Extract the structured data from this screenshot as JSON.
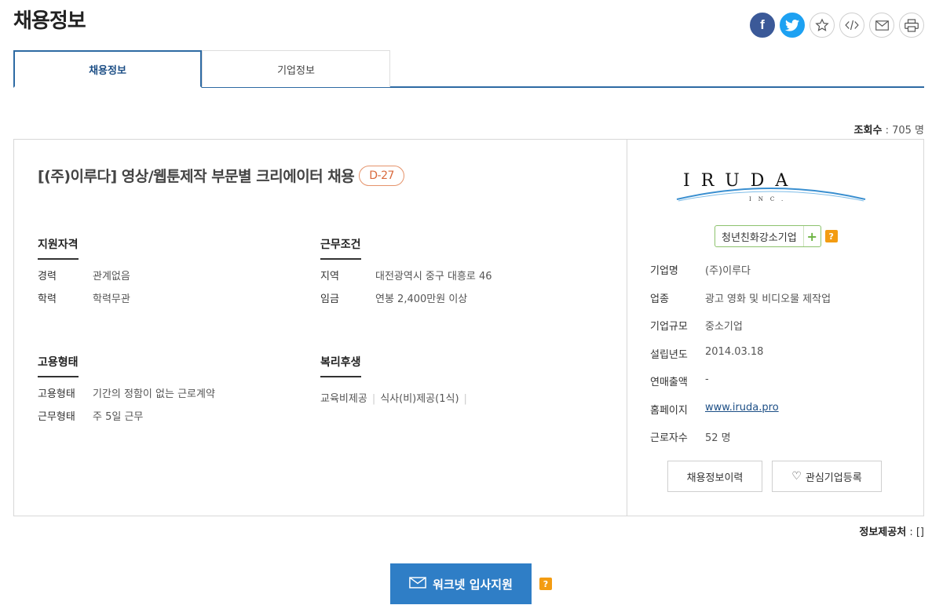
{
  "page": {
    "title": "채용정보"
  },
  "share": {
    "facebook": "f",
    "icons": [
      "facebook-icon",
      "twitter-icon",
      "star-icon",
      "code-icon",
      "mail-icon",
      "print-icon"
    ]
  },
  "tabs": [
    {
      "label": "채용정보",
      "active": true
    },
    {
      "label": "기업정보",
      "active": false
    }
  ],
  "views": {
    "label": "조회수",
    "sep": " : ",
    "value": "705 명"
  },
  "job": {
    "title": "[(주)이루다] 영상/웹툰제작 부문별 크리에이터 채용",
    "dday": "D-27"
  },
  "qualification": {
    "title": "지원자격",
    "rows": [
      {
        "k": "경력",
        "v": "관계없음"
      },
      {
        "k": "학력",
        "v": "학력무관"
      }
    ]
  },
  "conditions": {
    "title": "근무조건",
    "rows": [
      {
        "k": "지역",
        "v": "대전광역시 중구 대흥로 46"
      },
      {
        "k": "임금",
        "v": "연봉 2,400만원 이상"
      }
    ]
  },
  "employment": {
    "title": "고용형태",
    "rows": [
      {
        "k": "고용형태",
        "v": "기간의 정함이 없는 근로계약"
      },
      {
        "k": "근무형태",
        "v": "주 5일 근무"
      }
    ]
  },
  "welfare": {
    "title": "복리후생",
    "items": [
      "교육비제공",
      "식사(비)제공(1식)"
    ]
  },
  "company": {
    "logo_letters": "IRUDA",
    "logo_inc": "INC.",
    "badge": "청년친화강소기업",
    "badge_plus": "+",
    "help": "?",
    "rows": [
      {
        "k": "기업명",
        "v": "(주)이루다"
      },
      {
        "k": "업종",
        "v": "광고 영화 및 비디오물 제작업"
      },
      {
        "k": "기업규모",
        "v": "중소기업"
      },
      {
        "k": "설립년도",
        "v": "2014.03.18"
      },
      {
        "k": "연매출액",
        "v": "-"
      },
      {
        "k": "홈페이지",
        "v": "www.iruda.pro"
      },
      {
        "k": "근로자수",
        "v": "52 명"
      }
    ],
    "btn_history": "채용정보이력",
    "btn_favorite": "관심기업등록"
  },
  "source": {
    "label": "정보제공처",
    "sep": " : ",
    "value": "[]"
  },
  "apply": {
    "label": "워크넷 입사지원",
    "help": "?"
  },
  "colors": {
    "accent": "#2d6aa3",
    "apply": "#2f7ec6",
    "dday": "#d9693c",
    "badge": "#8dc26d",
    "help": "#f39c12"
  }
}
